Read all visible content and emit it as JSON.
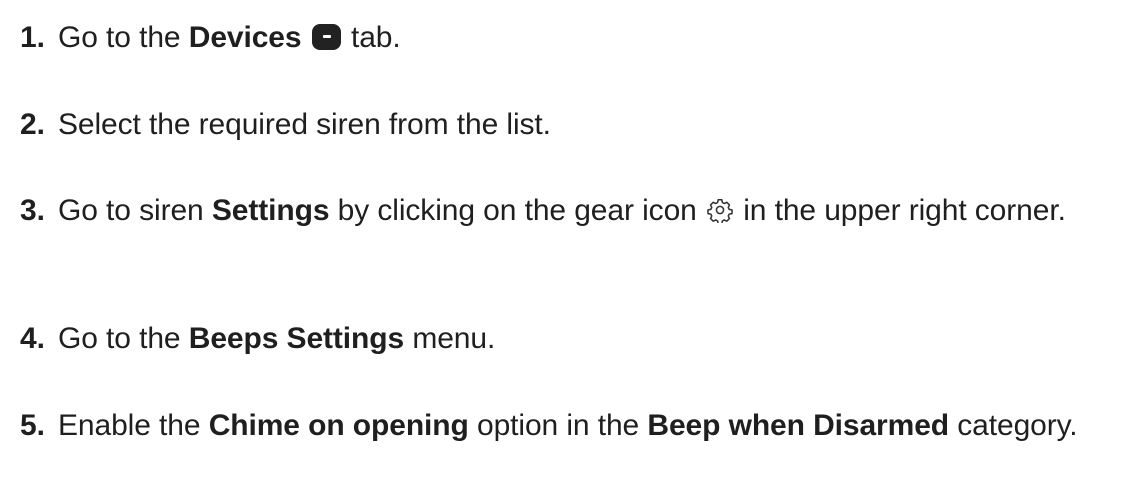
{
  "steps": [
    {
      "number": "1.",
      "text_before": "Go to the ",
      "bold": "Devices",
      "icon": "devices-tab-icon",
      "text_after": " tab."
    },
    {
      "number": "2.",
      "text": "Select the required siren from the list."
    },
    {
      "number": "3.",
      "text_before": "Go to siren ",
      "bold": "Settings",
      "text_middle": " by clicking on the gear icon ",
      "icon": "gear-icon",
      "text_after": " in the upper right corner."
    },
    {
      "number": "4.",
      "text_before": "Go to the ",
      "bold": "Beeps Settings",
      "text_after": " menu."
    },
    {
      "number": "5.",
      "text_before": "Enable the ",
      "bold": "Chime on opening",
      "text_middle": " option in the ",
      "bold2": "Beep when Disarmed",
      "text_after": " category."
    }
  ]
}
